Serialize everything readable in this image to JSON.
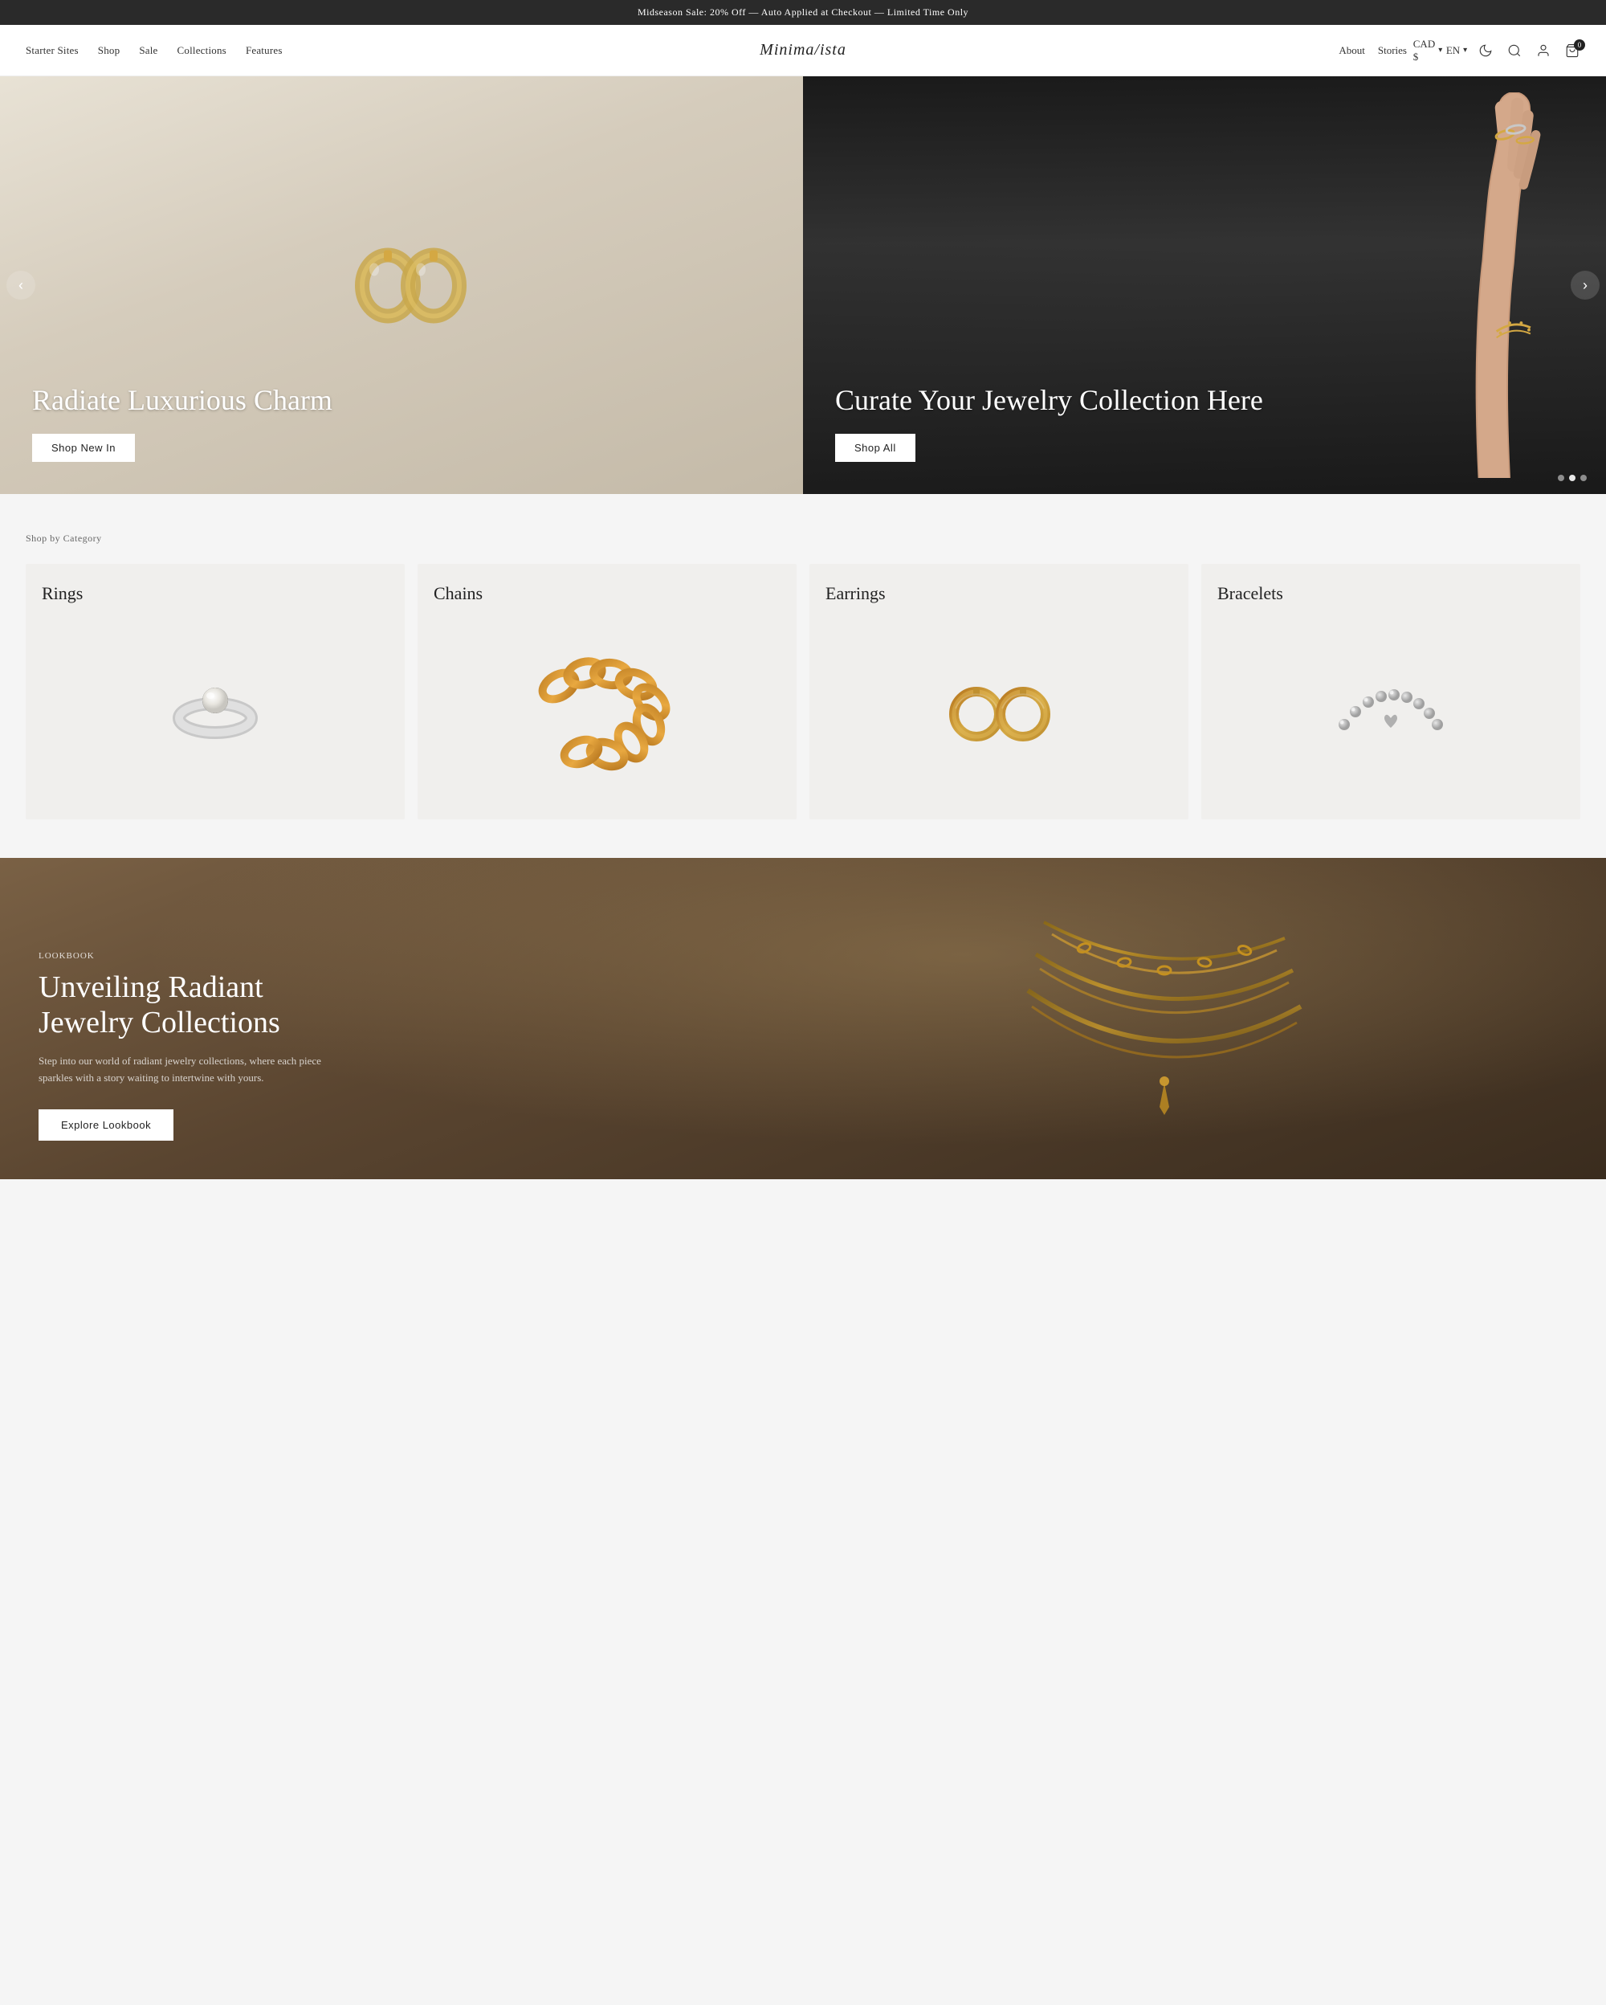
{
  "announcement": {
    "text": "Midseason Sale: 20% Off — Auto Applied at Checkout — Limited Time Only"
  },
  "nav": {
    "left_links": [
      {
        "label": "Starter Sites",
        "key": "starter-sites"
      },
      {
        "label": "Shop",
        "key": "shop"
      },
      {
        "label": "Sale",
        "key": "sale"
      },
      {
        "label": "Collections",
        "key": "collections"
      },
      {
        "label": "Features",
        "key": "features"
      }
    ],
    "logo": "Minima/ista",
    "right_links": [
      {
        "label": "About",
        "key": "about"
      },
      {
        "label": "Stories",
        "key": "stories"
      }
    ],
    "currency": "CAD $",
    "language": "EN",
    "cart_count": "0"
  },
  "hero": {
    "slides": [
      {
        "title": "Radiate Luxurious Charm",
        "button": "Shop New In",
        "side": "left"
      },
      {
        "title": "Curate Your Jewelry Collection Here",
        "button": "Shop All",
        "side": "right"
      }
    ],
    "prev_label": "‹",
    "next_label": "›",
    "active_dot": 0,
    "dots": 3
  },
  "categories": {
    "section_label": "Shop by Category",
    "items": [
      {
        "name": "Rings",
        "key": "rings"
      },
      {
        "name": "Chains",
        "key": "chains"
      },
      {
        "name": "Earrings",
        "key": "earrings"
      },
      {
        "name": "Bracelets",
        "key": "bracelets"
      }
    ]
  },
  "lookbook": {
    "tag": "Lookbook",
    "title": "Unveiling Radiant Jewelry Collections",
    "description": "Step into our world of radiant jewelry collections, where each piece sparkles with a story waiting to intertwine with yours.",
    "button": "Explore Lookbook"
  }
}
